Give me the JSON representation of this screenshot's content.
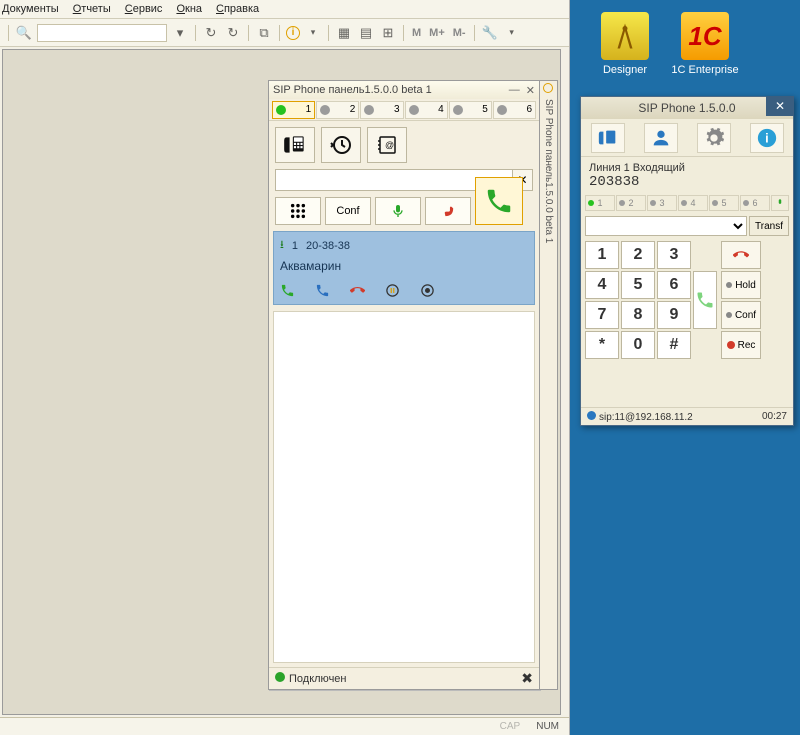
{
  "menu": {
    "items": [
      "Документы",
      "Отчеты",
      "Сервис",
      "Окна",
      "Справка"
    ]
  },
  "toolbar": {
    "search_placeholder": "",
    "m_items": [
      "M",
      "M+",
      "M-"
    ]
  },
  "statusbar": {
    "cap": "CAP",
    "num": "NUM"
  },
  "sip_panel": {
    "title": "SIP Phone панель1.5.0.0 beta 1",
    "side_caption": "SIP Phone панель1.5.0.0 beta 1",
    "lines": [
      "1",
      "2",
      "3",
      "4",
      "5",
      "6"
    ],
    "active_line": 1,
    "conf_label": "Conf",
    "input_value": "",
    "call_card": {
      "line": "1",
      "time": "20-38-38",
      "name": "Аквамарин"
    },
    "status_text": "Подключен"
  },
  "desktop": {
    "designer": "Designer",
    "enterprise": "1C Enterprise",
    "enterprise_glyph": "1C"
  },
  "sip_win": {
    "title": "SIP Phone 1.5.0.0",
    "info_line": "Линия 1 Входящий",
    "info_number": "203838",
    "lines": [
      "1",
      "2",
      "3",
      "4",
      "5",
      "6"
    ],
    "active_line": 1,
    "transfer_label": "Transf",
    "keypad": [
      "1",
      "2",
      "3",
      "4",
      "5",
      "6",
      "7",
      "8",
      "9",
      "*",
      "0",
      "#"
    ],
    "hold_label": "Hold",
    "conf_label": "Conf",
    "rec_label": "Rec",
    "sip_uri": "sip:11@192.168.11.2",
    "duration": "00:27"
  }
}
